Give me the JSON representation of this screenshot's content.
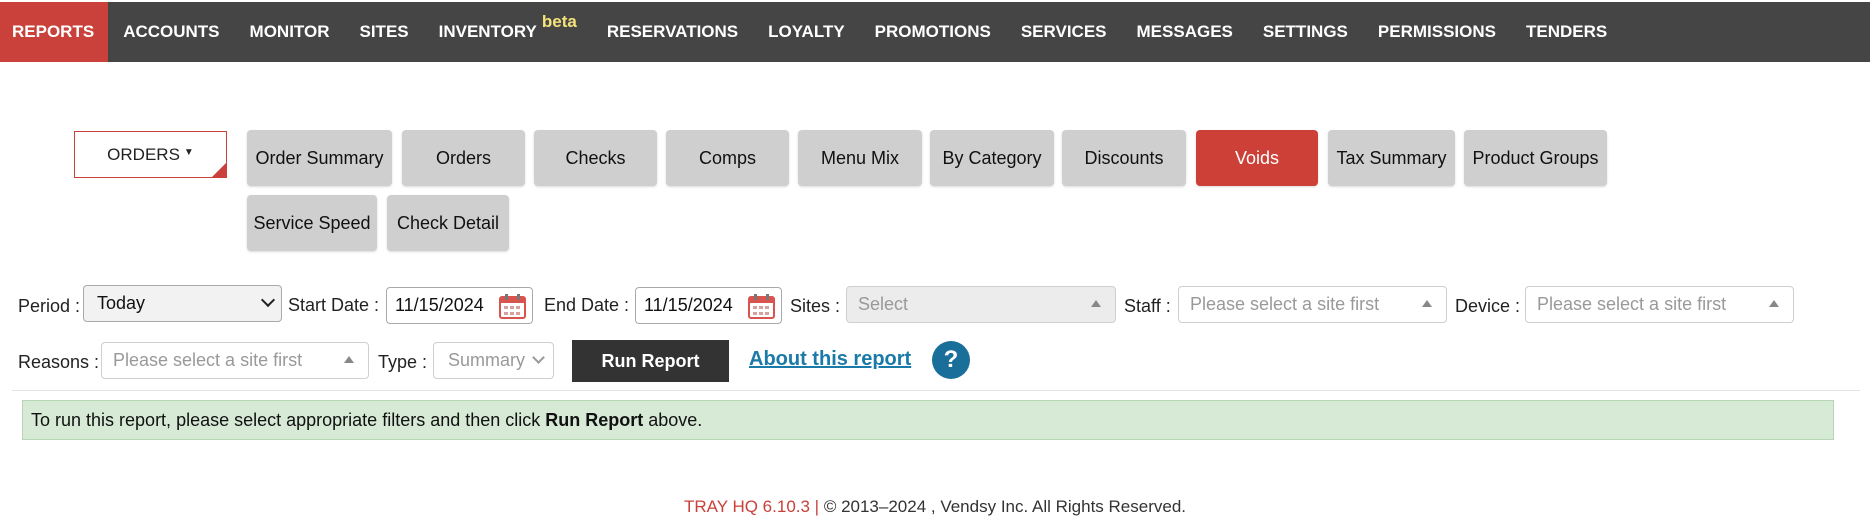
{
  "nav": {
    "items": [
      {
        "label": "REPORTS",
        "active": true
      },
      {
        "label": "ACCOUNTS"
      },
      {
        "label": "MONITOR"
      },
      {
        "label": "SITES"
      },
      {
        "label": "INVENTORY",
        "badge": "beta"
      },
      {
        "label": "RESERVATIONS"
      },
      {
        "label": "LOYALTY"
      },
      {
        "label": "PROMOTIONS"
      },
      {
        "label": "SERVICES"
      },
      {
        "label": "MESSAGES"
      },
      {
        "label": "SETTINGS"
      },
      {
        "label": "PERMISSIONS"
      },
      {
        "label": "TENDERS"
      }
    ]
  },
  "report_group": {
    "label": "ORDERS"
  },
  "report_tabs": [
    {
      "label": "Order Summary"
    },
    {
      "label": "Orders"
    },
    {
      "label": "Checks"
    },
    {
      "label": "Comps"
    },
    {
      "label": "Menu Mix"
    },
    {
      "label": "By Category"
    },
    {
      "label": "Discounts"
    },
    {
      "label": "Voids",
      "active": true
    },
    {
      "label": "Tax Summary"
    },
    {
      "label": "Product Groups"
    },
    {
      "label": "Service Speed"
    },
    {
      "label": "Check Detail"
    }
  ],
  "filters": {
    "period_label": "Period :",
    "period_value": "Today",
    "start_label": "Start Date :",
    "start_value": "11/15/2024",
    "end_label": "End Date :",
    "end_value": "11/15/2024",
    "sites_label": "Sites :",
    "sites_placeholder": "Select",
    "staff_label": "Staff :",
    "staff_placeholder": "Please select a site first",
    "device_label": "Device :",
    "device_placeholder": "Please select a site first",
    "reasons_label": "Reasons :",
    "reasons_placeholder": "Please select a site first",
    "type_label": "Type :",
    "type_value": "Summary",
    "run_label": "Run Report",
    "about_label": "About this report",
    "help_symbol": "?"
  },
  "notice": {
    "prefix": "To run this report, please select appropriate filters and then click ",
    "bold": "Run Report",
    "suffix": " above."
  },
  "footer": {
    "brand": "TRAY HQ 6.10.3 |",
    "copyright": " © 2013–2024 , Vendsy Inc. All Rights Reserved."
  },
  "colors": {
    "accent": "#c9413a",
    "nav_bg": "#454545",
    "tab_bg": "#cfcfcf",
    "link": "#1a7aa8",
    "notice_bg": "#d7ead6"
  }
}
